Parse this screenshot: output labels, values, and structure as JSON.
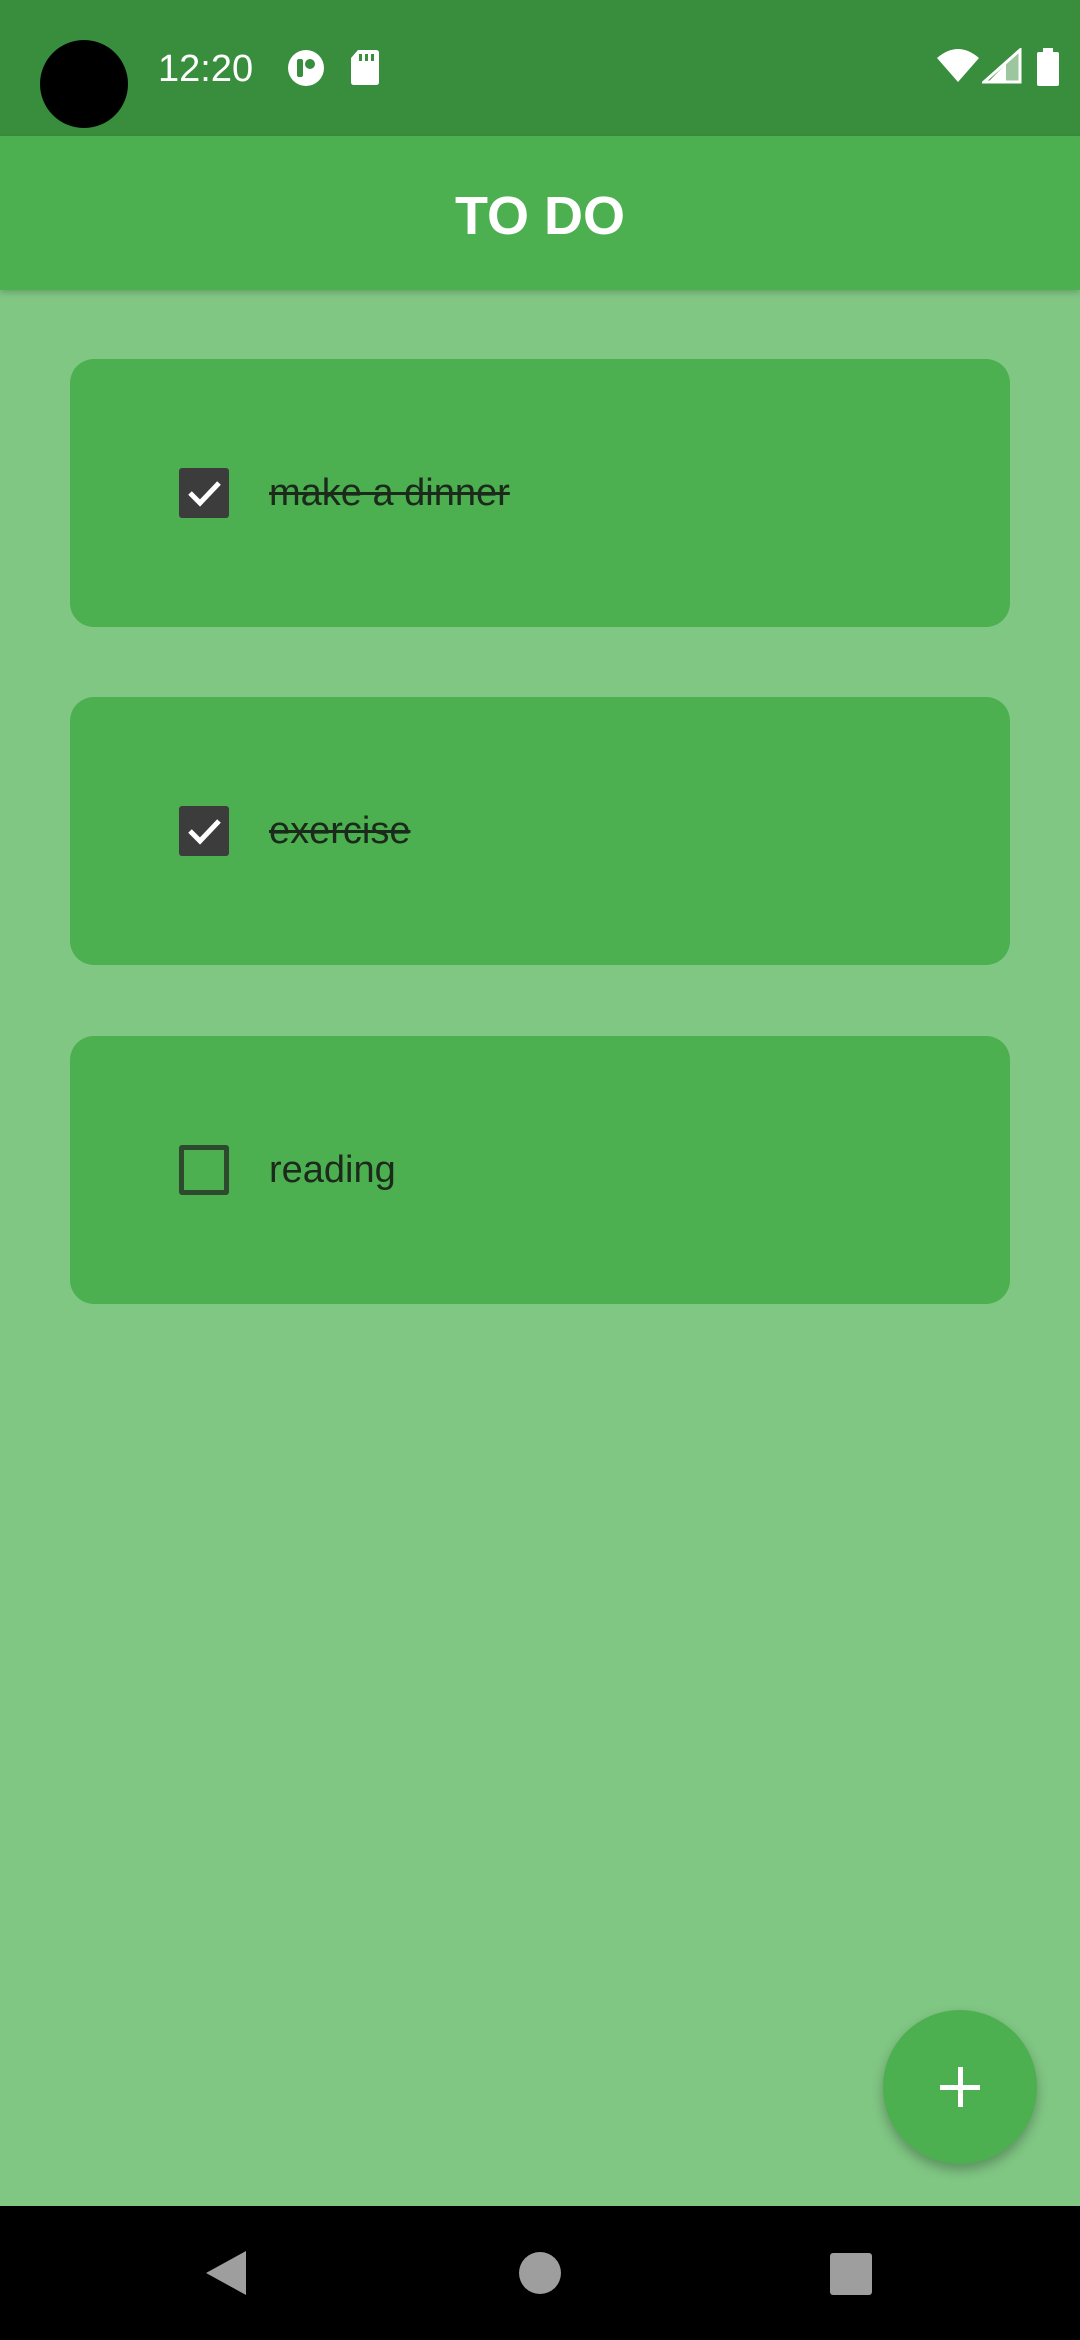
{
  "status_bar": {
    "time": "12:20",
    "icons": [
      "cast-icon",
      "sd-card-icon",
      "wifi-icon",
      "signal-icon",
      "battery-icon"
    ]
  },
  "app_bar": {
    "title": "TO DO"
  },
  "tasks": [
    {
      "label": "make a dinner",
      "checked": true
    },
    {
      "label": "exercise",
      "checked": true
    },
    {
      "label": "reading",
      "checked": false
    }
  ],
  "fab": {
    "icon": "plus-icon"
  },
  "nav_bar": {
    "icons": [
      "back-icon",
      "home-icon",
      "recents-icon"
    ]
  },
  "colors": {
    "background": "#81C784",
    "status_bar": "#388E3C",
    "app_bar": "#4CAF50",
    "card": "#4CAF50",
    "checkbox_checked": "#3C3C3C"
  }
}
